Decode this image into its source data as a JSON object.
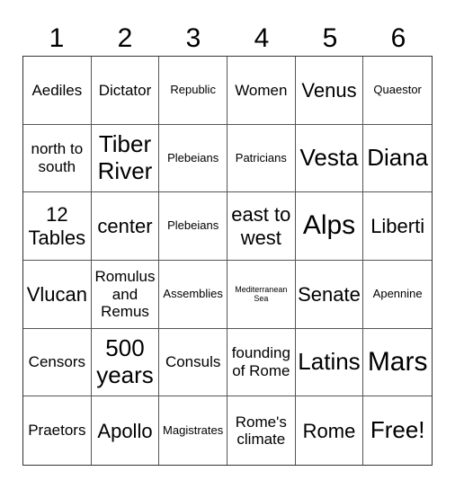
{
  "card": {
    "columns": [
      "1",
      "2",
      "3",
      "4",
      "5",
      "6"
    ],
    "rows": [
      [
        {
          "text": "Aediles",
          "size": "md"
        },
        {
          "text": "Dictator",
          "size": "md"
        },
        {
          "text": "Republic",
          "size": "sm"
        },
        {
          "text": "Women",
          "size": "md"
        },
        {
          "text": "Venus",
          "size": "lg"
        },
        {
          "text": "Quaestor",
          "size": "sm"
        }
      ],
      [
        {
          "text": "north to south",
          "size": "md"
        },
        {
          "text": "Tiber River",
          "size": "xl"
        },
        {
          "text": "Plebeians",
          "size": "sm"
        },
        {
          "text": "Patricians",
          "size": "sm"
        },
        {
          "text": "Vesta",
          "size": "xl"
        },
        {
          "text": "Diana",
          "size": "xl"
        }
      ],
      [
        {
          "text": "12 Tables",
          "size": "lg"
        },
        {
          "text": "center",
          "size": "lg"
        },
        {
          "text": "Plebeians",
          "size": "sm"
        },
        {
          "text": "east to west",
          "size": "lg"
        },
        {
          "text": "Alps",
          "size": "xxl"
        },
        {
          "text": "Liberti",
          "size": "lg"
        }
      ],
      [
        {
          "text": "Vlucan",
          "size": "lg"
        },
        {
          "text": "Romulus and Remus",
          "size": "md"
        },
        {
          "text": "Assemblies",
          "size": "sm"
        },
        {
          "text": "Mediterranean Sea",
          "size": "xs"
        },
        {
          "text": "Senate",
          "size": "lg"
        },
        {
          "text": "Apennine",
          "size": "sm"
        }
      ],
      [
        {
          "text": "Censors",
          "size": "md"
        },
        {
          "text": "500 years",
          "size": "xl"
        },
        {
          "text": "Consuls",
          "size": "md"
        },
        {
          "text": "founding of Rome",
          "size": "md"
        },
        {
          "text": "Latins",
          "size": "xl"
        },
        {
          "text": "Mars",
          "size": "xxl"
        }
      ],
      [
        {
          "text": "Praetors",
          "size": "md"
        },
        {
          "text": "Apollo",
          "size": "lg"
        },
        {
          "text": "Magistrates",
          "size": "sm"
        },
        {
          "text": "Rome's climate",
          "size": "md"
        },
        {
          "text": "Rome",
          "size": "lg"
        },
        {
          "text": "Free!",
          "size": "xl"
        }
      ]
    ]
  }
}
